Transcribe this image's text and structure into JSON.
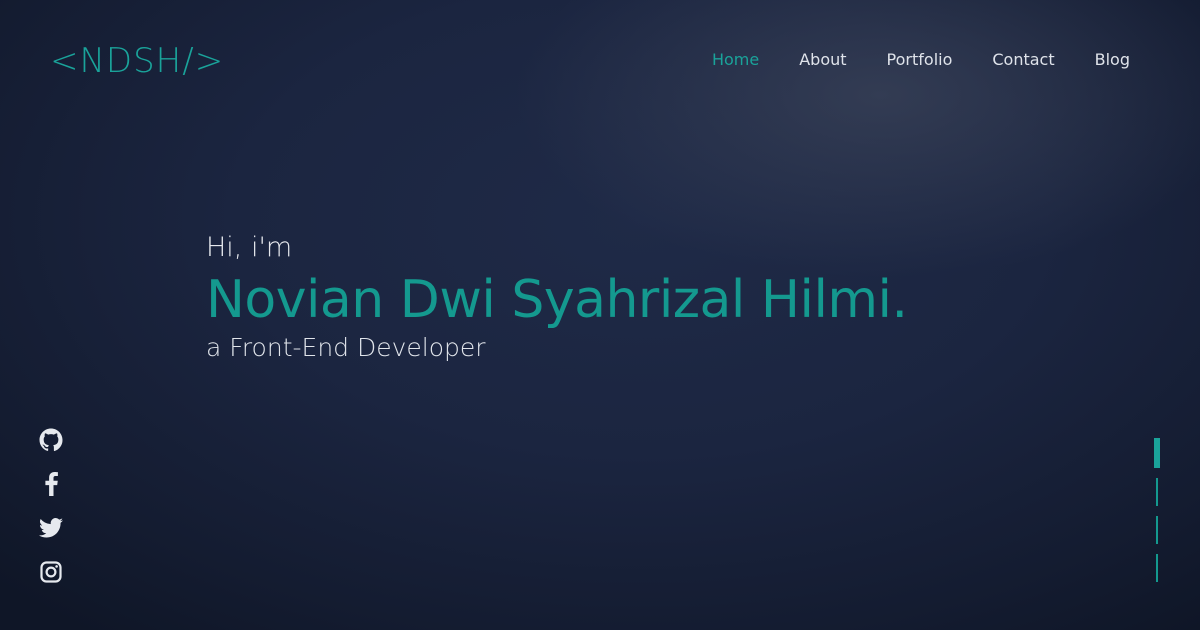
{
  "header": {
    "logo": "<NDSH/>",
    "nav": [
      {
        "label": "Home",
        "active": true
      },
      {
        "label": "About",
        "active": false
      },
      {
        "label": "Portfolio",
        "active": false
      },
      {
        "label": "Contact",
        "active": false
      },
      {
        "label": "Blog",
        "active": false
      }
    ]
  },
  "hero": {
    "greeting": "Hi, i'm",
    "name": "Novian Dwi Syahrizal Hilmi.",
    "role": "a Front-End Developer"
  },
  "socials": [
    {
      "icon": "github-icon"
    },
    {
      "icon": "facebook-icon"
    },
    {
      "icon": "twitter-icon"
    },
    {
      "icon": "instagram-icon"
    }
  ],
  "section_indicator": {
    "count": 4,
    "active_index": 0
  },
  "colors": {
    "accent": "#1aa39a",
    "text": "#e1e5eb",
    "background": "#1b2540"
  }
}
